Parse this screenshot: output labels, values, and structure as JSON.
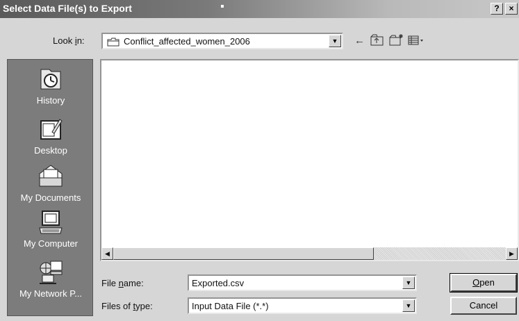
{
  "window": {
    "title": "Select Data File(s) to Export",
    "help_label": "?",
    "close_label": "×"
  },
  "lookin": {
    "label_pre": "Look ",
    "label_key": "i",
    "label_post": "n:",
    "value": "Conflict_affected_women_2006"
  },
  "toolbar": {
    "back_icon": "←",
    "up_icon": "⮤",
    "new_folder_icon": "✱",
    "views_icon": "▦▾"
  },
  "places": [
    {
      "label": "History",
      "icon": "history-icon"
    },
    {
      "label": "Desktop",
      "icon": "desktop-icon"
    },
    {
      "label": "My Documents",
      "icon": "documents-icon"
    },
    {
      "label": "My Computer",
      "icon": "computer-icon"
    },
    {
      "label": "My Network P...",
      "icon": "network-icon"
    }
  ],
  "filename": {
    "label_pre": "File ",
    "label_key": "n",
    "label_post": "ame:",
    "value": "Exported.csv"
  },
  "filetype": {
    "label_pre": "Files of ",
    "label_key": "t",
    "label_post": "ype:",
    "value": "Input Data File (*.*)"
  },
  "buttons": {
    "open_key": "O",
    "open_rest": "pen",
    "cancel": "Cancel"
  }
}
